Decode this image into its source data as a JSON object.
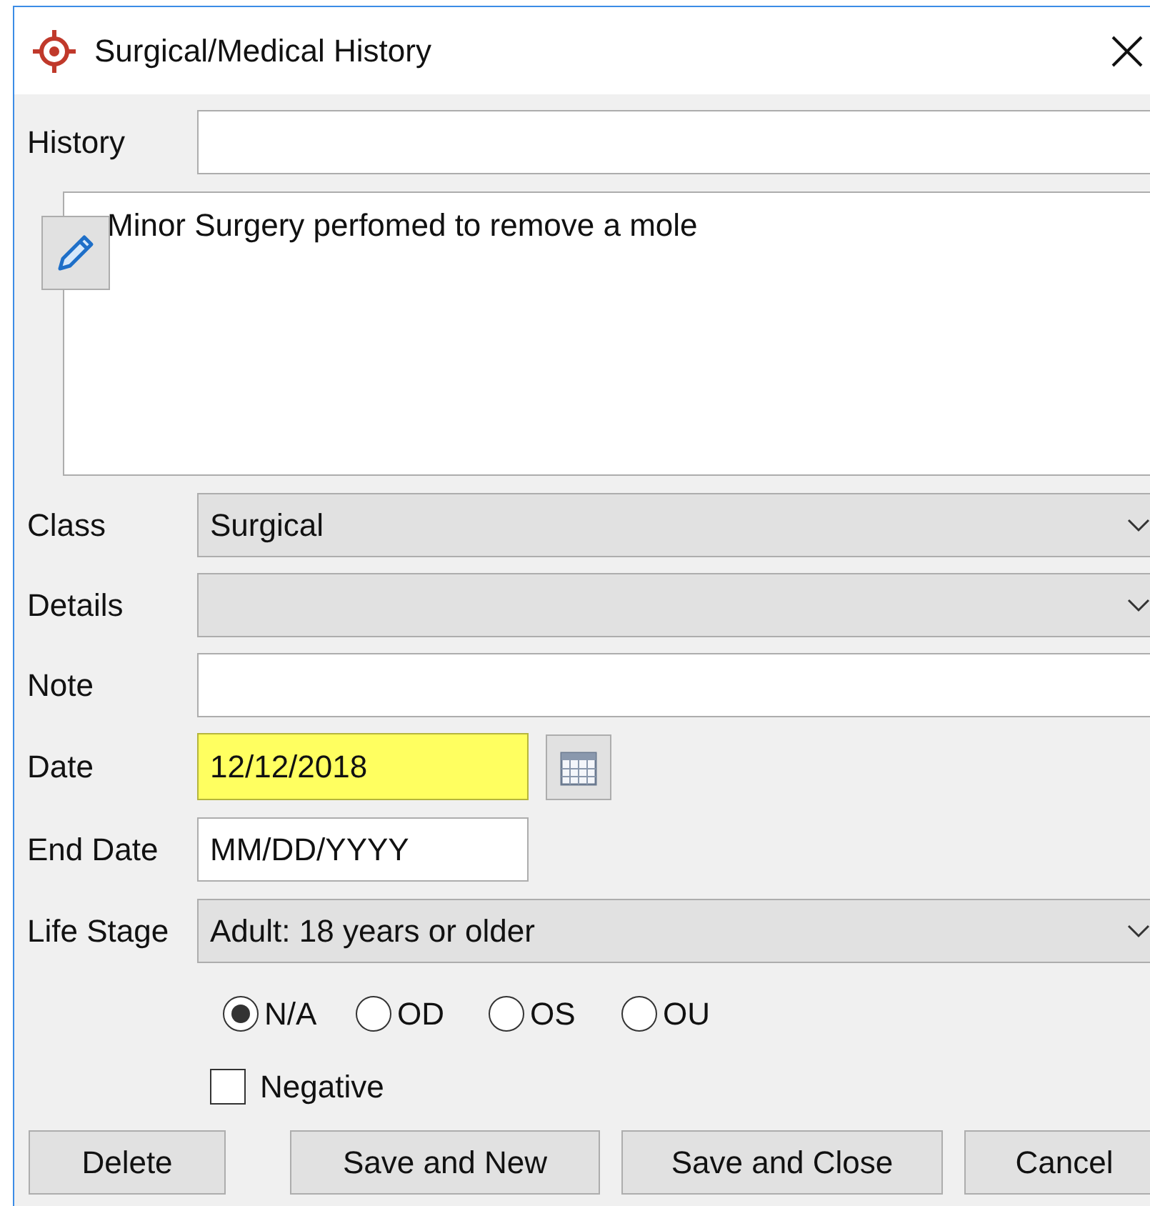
{
  "window": {
    "title": "Surgical/Medical History"
  },
  "history": {
    "label": "History"
  },
  "description": {
    "value": "Minor Surgery perfomed to remove a mole"
  },
  "class": {
    "label": "Class",
    "value": "Surgical"
  },
  "details": {
    "label": "Details"
  },
  "note": {
    "label": "Note"
  },
  "date": {
    "label": "Date",
    "value": "12/12/2018",
    "highlighted": true
  },
  "end_date": {
    "label": "End Date",
    "placeholder": "MM/DD/YYYY"
  },
  "life_stage": {
    "label": "Life Stage",
    "value": "Adult: 18 years or older"
  },
  "eye_options": [
    {
      "label": "N/A",
      "selected": true
    },
    {
      "label": "OD",
      "selected": false
    },
    {
      "label": "OS",
      "selected": false
    },
    {
      "label": "OU",
      "selected": false
    }
  ],
  "negative": {
    "label": "Negative",
    "checked": false
  },
  "buttons": [
    {
      "label": "Delete"
    },
    {
      "label": "Save and New"
    },
    {
      "label": "Save and Close"
    },
    {
      "label": "Cancel"
    }
  ]
}
